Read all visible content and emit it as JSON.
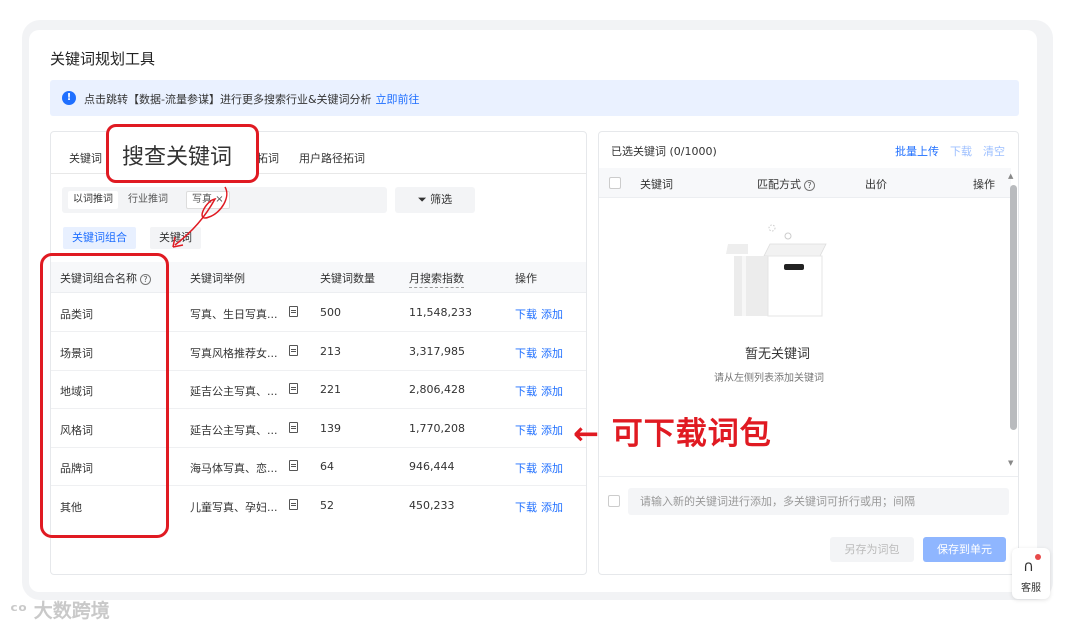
{
  "title": "关键词规划工具",
  "notice": {
    "text": "点击跳转【数据-流量参谋】进行更多搜索行业&关键词分析",
    "link": "立即前往"
  },
  "tabs": [
    "关键词",
    "拓词",
    "用户路径拓词"
  ],
  "annotation_box_label": "搜查关键词",
  "filter": {
    "chips": [
      "以词推词",
      "行业推词"
    ],
    "tag": "写真",
    "tag_close": "×",
    "button": "筛选"
  },
  "segments": [
    "关键词组合",
    "关键词"
  ],
  "table": {
    "headers": [
      "关键词组合名称",
      "关键词举例",
      "关键词数量",
      "月搜索指数",
      "操作"
    ],
    "rows": [
      {
        "name": "品类词",
        "example": "写真、生日写真...",
        "count": "500",
        "index": "11,548,233",
        "download": "下载",
        "add": "添加"
      },
      {
        "name": "场景词",
        "example": "写真风格推荐女...",
        "count": "213",
        "index": "3,317,985",
        "download": "下载",
        "add": "添加"
      },
      {
        "name": "地域词",
        "example": "延吉公主写真、...",
        "count": "221",
        "index": "2,806,428",
        "download": "下载",
        "add": "添加"
      },
      {
        "name": "风格词",
        "example": "延吉公主写真、...",
        "count": "139",
        "index": "1,770,208",
        "download": "下载",
        "add": "添加"
      },
      {
        "name": "品牌词",
        "example": "海马体写真、恋...",
        "count": "64",
        "index": "946,444",
        "download": "下载",
        "add": "添加"
      },
      {
        "name": "其他",
        "example": "儿童写真、孕妇...",
        "count": "52",
        "index": "450,233",
        "download": "下载",
        "add": "添加"
      }
    ]
  },
  "callout": "← 可下载词包",
  "right": {
    "selected": "已选关键词 (0/1000)",
    "batch_upload": "批量上传",
    "download": "下载",
    "clear": "清空",
    "headers": [
      "关键词",
      "匹配方式",
      "出价",
      "操作"
    ],
    "empty_title": "暂无关键词",
    "empty_sub": "请从左侧列表添加关键词",
    "input_placeholder": "请输入新的关键词进行添加，多关键词可折行或用；间隔",
    "save_package": "另存为词包",
    "save_unit": "保存到单元"
  },
  "kefu": "客服",
  "watermark": "大数跨境",
  "colors": {
    "accent": "#1f6fff",
    "annotation": "#e01a22"
  }
}
